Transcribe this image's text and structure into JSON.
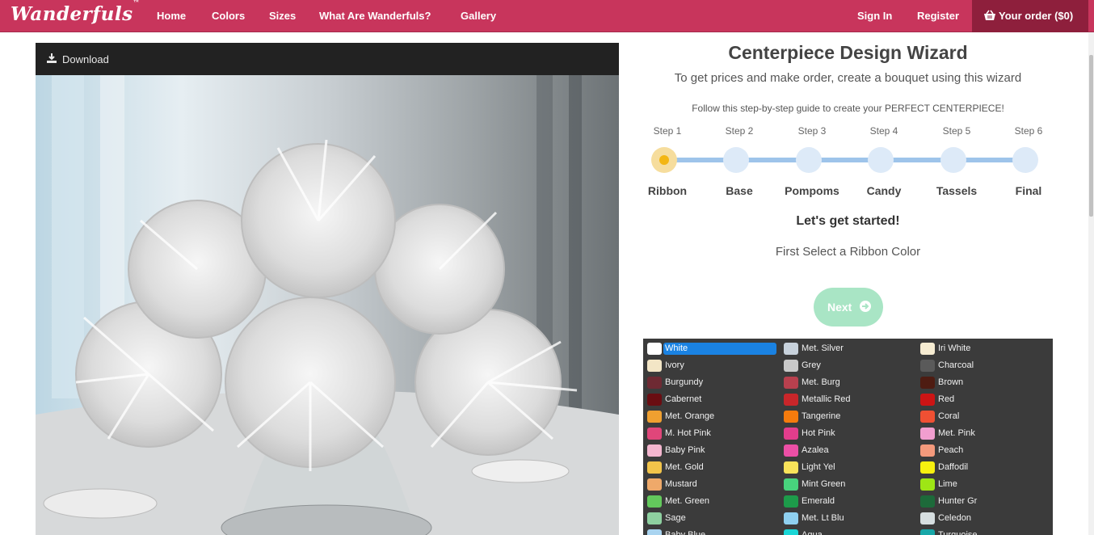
{
  "brand": {
    "logo": "Wanderfuls",
    "logo_mark": "™"
  },
  "nav": {
    "links": [
      "Home",
      "Colors",
      "Sizes",
      "What Are Wanderfuls?",
      "Gallery"
    ],
    "sign_in": "Sign In",
    "register": "Register",
    "order": "Your order ($0)"
  },
  "preview": {
    "download": "Download"
  },
  "wizard": {
    "title": "Centerpiece Design Wizard",
    "subtitle": "To get prices and make order, create a bouquet using this wizard",
    "guide": "Follow this step-by-step guide to create your PERFECT CENTERPIECE!",
    "steps": [
      {
        "num": "Step 1",
        "name": "Ribbon",
        "active": true
      },
      {
        "num": "Step 2",
        "name": "Base",
        "active": false
      },
      {
        "num": "Step 3",
        "name": "Pompoms",
        "active": false
      },
      {
        "num": "Step 4",
        "name": "Candy",
        "active": false
      },
      {
        "num": "Step 5",
        "name": "Tassels",
        "active": false
      },
      {
        "num": "Step 6",
        "name": "Final",
        "active": false
      }
    ],
    "heading": "Let's get started!",
    "instruction": "First Select a Ribbon Color",
    "next": "Next"
  },
  "colors": {
    "selected": "White",
    "col1": [
      {
        "name": "White",
        "color": "#ffffff"
      },
      {
        "name": "Ivory",
        "color": "#f3e6c6"
      },
      {
        "name": "Burgundy",
        "color": "#6e2a33"
      },
      {
        "name": "Cabernet",
        "color": "#6a0d12"
      },
      {
        "name": "Met. Orange",
        "color": "#f0a030"
      },
      {
        "name": "M. Hot Pink",
        "color": "#e0467a"
      },
      {
        "name": "Baby Pink",
        "color": "#f4b6cf"
      },
      {
        "name": "Met. Gold",
        "color": "#f2c44a"
      },
      {
        "name": "Mustard",
        "color": "#efa96a"
      },
      {
        "name": "Met. Green",
        "color": "#63c95c"
      },
      {
        "name": "Sage",
        "color": "#8ed0a0"
      },
      {
        "name": "Baby Blue",
        "color": "#a9d4f0"
      }
    ],
    "col2": [
      {
        "name": "Met. Silver",
        "color": "#c8d2dc"
      },
      {
        "name": "Grey",
        "color": "#c9c9c9"
      },
      {
        "name": "Met. Burg",
        "color": "#b8404e"
      },
      {
        "name": "Metallic Red",
        "color": "#c9262a"
      },
      {
        "name": "Tangerine",
        "color": "#f57b0d"
      },
      {
        "name": "Hot Pink",
        "color": "#e23d8c"
      },
      {
        "name": "Azalea",
        "color": "#ec4fa6"
      },
      {
        "name": "Light Yel",
        "color": "#f8e35a"
      },
      {
        "name": "Mint Green",
        "color": "#48d37d"
      },
      {
        "name": "Emerald",
        "color": "#1d9b4a"
      },
      {
        "name": "Met. Lt Blu",
        "color": "#8fd0f0"
      },
      {
        "name": "Aqua",
        "color": "#1ad6d6"
      }
    ],
    "col3": [
      {
        "name": "Iri White",
        "color": "#f6ecd2"
      },
      {
        "name": "Charcoal",
        "color": "#5a5a5a"
      },
      {
        "name": "Brown",
        "color": "#4e1c12"
      },
      {
        "name": "Red",
        "color": "#cc1414"
      },
      {
        "name": "Coral",
        "color": "#f05033"
      },
      {
        "name": "Met. Pink",
        "color": "#f19ecf"
      },
      {
        "name": "Peach",
        "color": "#f59a7c"
      },
      {
        "name": "Daffodil",
        "color": "#f7f00f"
      },
      {
        "name": "Lime",
        "color": "#9ee615"
      },
      {
        "name": "Hunter Gr",
        "color": "#1d6a3a"
      },
      {
        "name": "Celedon",
        "color": "#d6dee0"
      },
      {
        "name": "Turquoise",
        "color": "#18a7a8"
      }
    ]
  },
  "colors_theme": {
    "nav_bg": "#c8355c",
    "order_bg": "#8e1f3c",
    "active_step": "#f3b613",
    "step_track": "#9ec4ea",
    "next_bg": "#a9e5c5",
    "selected_bg": "#1a82e2"
  }
}
